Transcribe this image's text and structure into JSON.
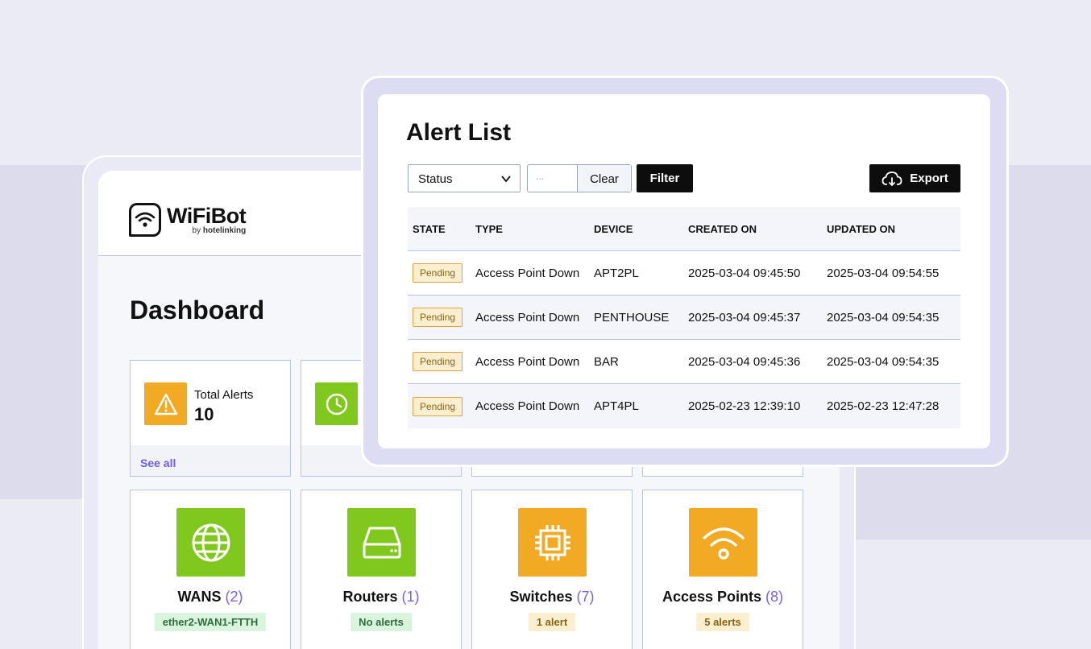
{
  "dashboard": {
    "logo": {
      "name": "WiFiBot",
      "sub_by": "by",
      "sub_brand": "hotelinking"
    },
    "title": "Dashboard",
    "stats": [
      {
        "label": "Total Alerts",
        "value": "10",
        "link": "See all",
        "icon": "warning-icon",
        "color": "#f2a924"
      },
      {
        "icon": "clock-icon",
        "color": "#80c81e"
      }
    ],
    "devices": [
      {
        "name": "WANS",
        "count": "(2)",
        "tag": "ether2-WAN1-FTTH",
        "tag_status": "ok",
        "icon": "globe-icon",
        "color": "#80c81e"
      },
      {
        "name": "Routers",
        "count": "(1)",
        "tag": "No alerts",
        "tag_status": "ok",
        "icon": "router-icon",
        "color": "#80c81e"
      },
      {
        "name": "Switches",
        "count": "(7)",
        "tag": "1 alert",
        "tag_status": "warn",
        "icon": "chip-icon",
        "color": "#f2a924"
      },
      {
        "name": "Access Points",
        "count": "(8)",
        "tag": "5 alerts",
        "tag_status": "warn",
        "icon": "wifi-icon",
        "color": "#f2a924"
      }
    ]
  },
  "alert_list": {
    "title": "Alert List",
    "status_select": "Status",
    "date_placeholder": "...",
    "clear_label": "Clear",
    "filter_label": "Filter",
    "export_label": "Export",
    "columns": [
      "STATE",
      "TYPE",
      "DEVICE",
      "CREATED ON",
      "UPDATED ON"
    ],
    "rows": [
      {
        "state": "Pending",
        "type": "Access Point Down",
        "device": "APT2PL",
        "created": "2025-03-04 09:45:50",
        "updated": "2025-03-04 09:54:55"
      },
      {
        "state": "Pending",
        "type": "Access Point Down",
        "device": "PENTHOUSE",
        "created": "2025-03-04 09:45:37",
        "updated": "2025-03-04 09:54:35"
      },
      {
        "state": "Pending",
        "type": "Access Point Down",
        "device": "BAR",
        "created": "2025-03-04 09:45:36",
        "updated": "2025-03-04 09:54:35"
      },
      {
        "state": "Pending",
        "type": "Access Point Down",
        "device": "APT4PL",
        "created": "2025-02-23 12:39:10",
        "updated": "2025-02-23 12:47:28"
      }
    ]
  }
}
